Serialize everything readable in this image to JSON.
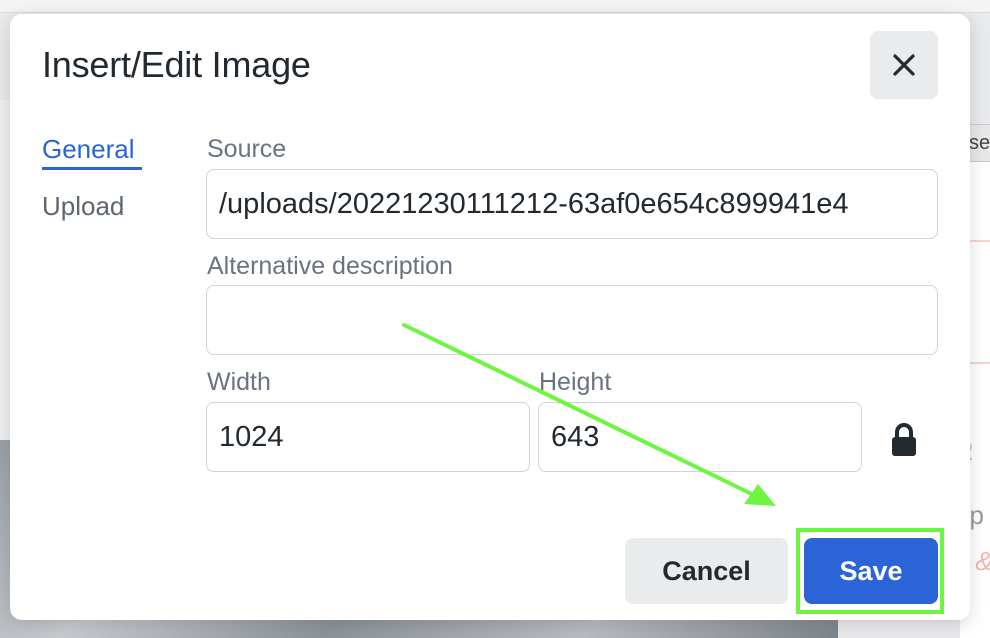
{
  "dialog": {
    "title": "Insert/Edit Image",
    "close_tooltip": "Close",
    "tabs": [
      {
        "label": "General",
        "active": true
      },
      {
        "label": "Upload",
        "active": false
      }
    ],
    "source": {
      "label": "Source",
      "value": "/uploads/20221230111212-63af0e654c899941e4"
    },
    "alt": {
      "label": "Alternative description",
      "value": ""
    },
    "width": {
      "label": "Width",
      "value": "1024"
    },
    "height": {
      "label": "Height",
      "value": "643"
    },
    "lock_icon": "lock-icon",
    "cancel_label": "Cancel",
    "save_label": "Save"
  },
  "background": {
    "right_letters": [
      "R",
      "up",
      "s &"
    ]
  },
  "colors": {
    "accent": "#2a64d6",
    "annotation": "#6ef542"
  }
}
